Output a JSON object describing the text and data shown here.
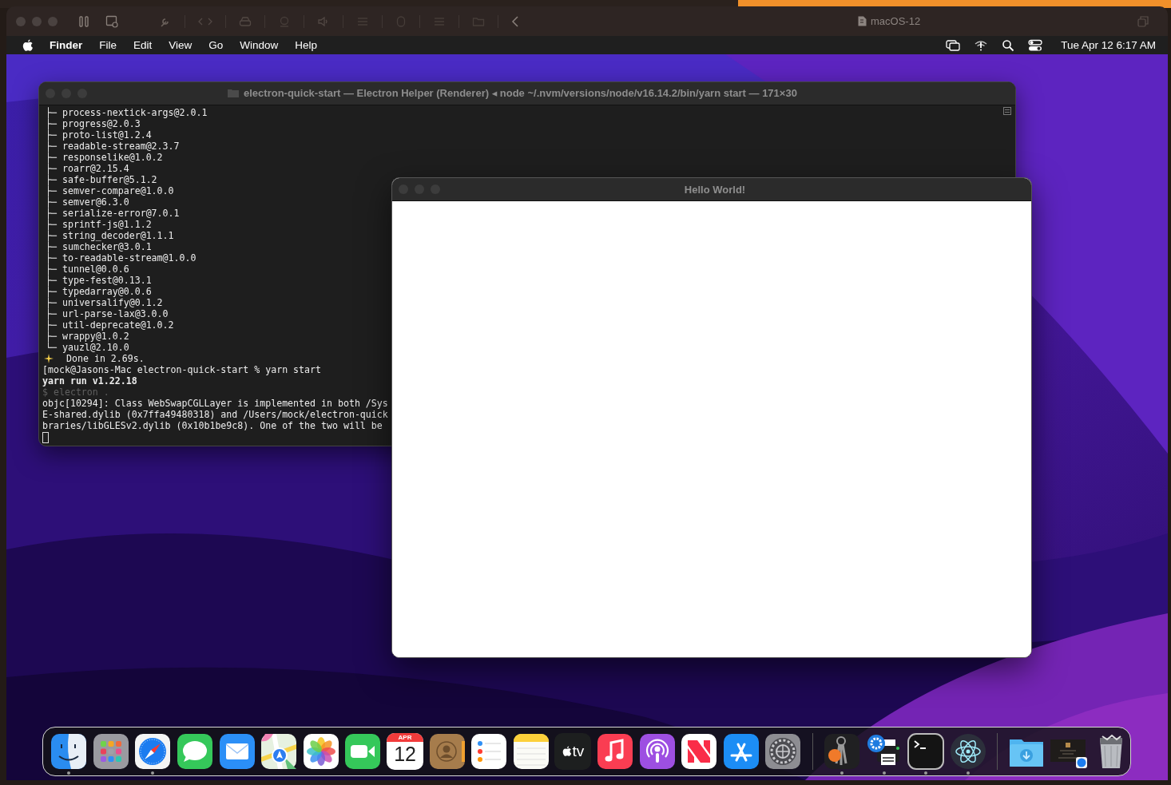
{
  "vm_toolbar": {
    "title": "macOS-12"
  },
  "menu_bar": {
    "app": "Finder",
    "menus": [
      "File",
      "Edit",
      "View",
      "Go",
      "Window",
      "Help"
    ],
    "clock": "Tue Apr 12  6:17 AM"
  },
  "terminal": {
    "title": "electron-quick-start — Electron Helper (Renderer) ◂ node ~/.nvm/versions/node/v16.14.2/bin/yarn start — 171×30",
    "lines": [
      {
        "kind": "tree",
        "text": "├─ process-nextick-args@2.0.1"
      },
      {
        "kind": "tree",
        "text": "├─ progress@2.0.3"
      },
      {
        "kind": "tree",
        "text": "├─ proto-list@1.2.4"
      },
      {
        "kind": "tree",
        "text": "├─ readable-stream@2.3.7"
      },
      {
        "kind": "tree",
        "text": "├─ responselike@1.0.2"
      },
      {
        "kind": "tree",
        "text": "├─ roarr@2.15.4"
      },
      {
        "kind": "tree",
        "text": "├─ safe-buffer@5.1.2"
      },
      {
        "kind": "tree",
        "text": "├─ semver-compare@1.0.0"
      },
      {
        "kind": "tree",
        "text": "├─ semver@6.3.0"
      },
      {
        "kind": "tree",
        "text": "├─ serialize-error@7.0.1"
      },
      {
        "kind": "tree",
        "text": "├─ sprintf-js@1.1.2"
      },
      {
        "kind": "tree",
        "text": "├─ string_decoder@1.1.1"
      },
      {
        "kind": "tree",
        "text": "├─ sumchecker@3.0.1"
      },
      {
        "kind": "tree",
        "text": "├─ to-readable-stream@1.0.0"
      },
      {
        "kind": "tree",
        "text": "├─ tunnel@0.0.6"
      },
      {
        "kind": "tree",
        "text": "├─ type-fest@0.13.1"
      },
      {
        "kind": "tree",
        "text": "├─ typedarray@0.0.6"
      },
      {
        "kind": "tree",
        "text": "├─ universalify@0.1.2"
      },
      {
        "kind": "tree",
        "text": "├─ url-parse-lax@3.0.0"
      },
      {
        "kind": "tree",
        "text": "├─ util-deprecate@1.0.2"
      },
      {
        "kind": "tree",
        "text": "├─ wrappy@1.0.2"
      },
      {
        "kind": "tree",
        "text": "└─ yauzl@2.10.0"
      },
      {
        "kind": "done",
        "text": "Done in 2.69s."
      },
      {
        "kind": "plain",
        "text": "[mock@Jasons-Mac electron-quick-start % yarn start"
      },
      {
        "kind": "bold",
        "text": "yarn run v1.22.18"
      },
      {
        "kind": "dim",
        "text": "$ electron ."
      },
      {
        "kind": "plain",
        "text": "objc[10294]: Class WebSwapCGLLayer is implemented in both /Sys"
      },
      {
        "kind": "plain",
        "text": "E-shared.dylib (0x7ffa49480318) and /Users/mock/electron-quick"
      },
      {
        "kind": "plain",
        "text": "braries/libGLESv2.dylib (0x10b1be9c8). One of the two will be"
      },
      {
        "kind": "cursor"
      }
    ]
  },
  "app_window": {
    "title": "Hello World!"
  },
  "dock": {
    "items": [
      {
        "kind": "finder",
        "running": true
      },
      {
        "kind": "launchpad",
        "running": false
      },
      {
        "kind": "safari",
        "running": true
      },
      {
        "kind": "messages",
        "running": false
      },
      {
        "kind": "mail",
        "running": false
      },
      {
        "kind": "maps",
        "running": false
      },
      {
        "kind": "photos",
        "running": false
      },
      {
        "kind": "facetime",
        "running": false
      },
      {
        "kind": "calendar",
        "running": false,
        "month": "APR",
        "day": "12"
      },
      {
        "kind": "contacts",
        "running": false
      },
      {
        "kind": "reminders",
        "running": false
      },
      {
        "kind": "notes",
        "running": false
      },
      {
        "kind": "tv",
        "running": false,
        "label": "tv"
      },
      {
        "kind": "music",
        "running": false
      },
      {
        "kind": "podcasts",
        "running": false
      },
      {
        "kind": "news",
        "running": false
      },
      {
        "kind": "appstore",
        "running": false
      },
      {
        "kind": "settings",
        "running": false
      },
      {
        "kind": "separator"
      },
      {
        "kind": "keychain",
        "running": true
      },
      {
        "kind": "printer",
        "running": true
      },
      {
        "kind": "terminal",
        "running": true
      },
      {
        "kind": "electron",
        "running": true
      },
      {
        "kind": "separator"
      },
      {
        "kind": "downloads",
        "running": false
      },
      {
        "kind": "screenshot",
        "running": false
      },
      {
        "kind": "trash",
        "running": false
      }
    ]
  }
}
